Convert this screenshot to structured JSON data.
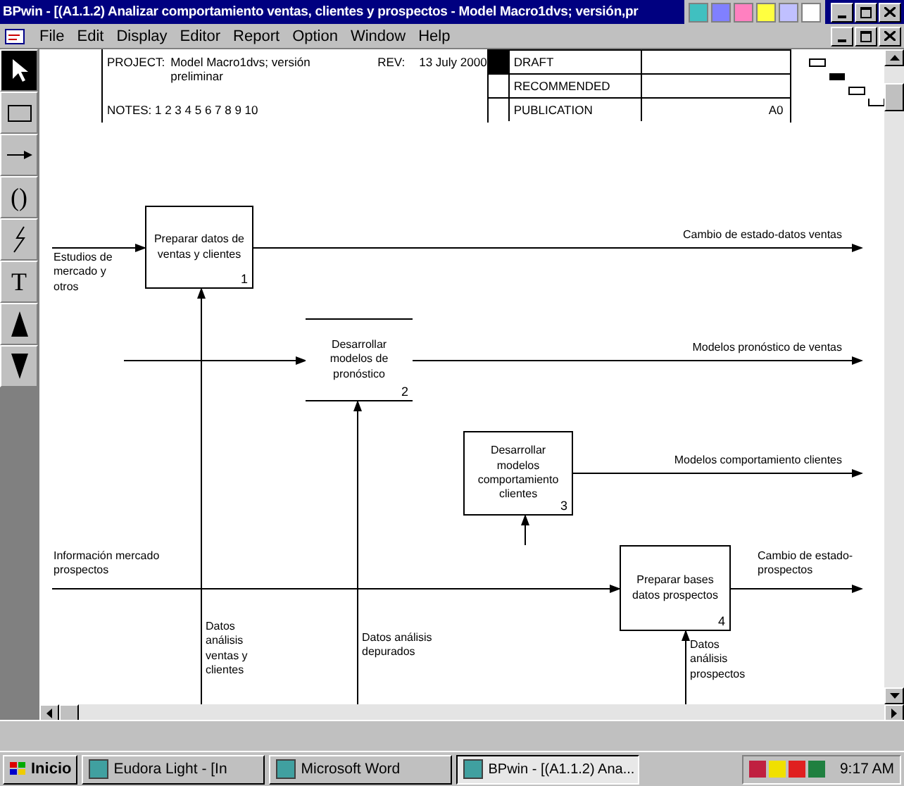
{
  "window": {
    "title": "BPwin - [(A1.1.2) Analizar comportamiento ventas, clientes y prospectos - Model Macro1dvs; versión,pr"
  },
  "menu": [
    "File",
    "Edit",
    "Display",
    "Editor",
    "Report",
    "Option",
    "Window",
    "Help"
  ],
  "tools": [
    {
      "kind": "pointer",
      "selected": true
    },
    {
      "kind": "rectangle",
      "selected": false
    },
    {
      "kind": "arrow",
      "selected": false
    },
    {
      "kind": "glyph",
      "glyph": "()",
      "selected": false
    },
    {
      "kind": "squiggle",
      "selected": false
    },
    {
      "kind": "glyph",
      "glyph": "T",
      "selected": false
    },
    {
      "kind": "up",
      "selected": false
    },
    {
      "kind": "down",
      "selected": false
    }
  ],
  "header": {
    "project_label": "PROJECT:",
    "project": "Model Macro1dvs; versión preliminar",
    "rev_label": "REV:",
    "rev": "13 July 2000",
    "notes": "NOTES: 1 2 3 4 5 6 7 8 9 10",
    "context": "A0",
    "statuses": [
      {
        "label": "DRAFT",
        "selected": true
      },
      {
        "label": "RECOMMENDED",
        "selected": false
      },
      {
        "label": "PUBLICATION",
        "selected": false
      }
    ]
  },
  "activities": [
    {
      "kind": "box",
      "name": "Preparar datos de ventas y clientes",
      "number": "1"
    },
    {
      "kind": "open",
      "name": "Desarrollar modelos de pronóstico",
      "number": "2"
    },
    {
      "kind": "box",
      "name": "Desarrollar modelos comportamiento clientes",
      "number": "3"
    },
    {
      "kind": "box",
      "name": "Preparar bases datos prospectos",
      "number": "4"
    }
  ],
  "arrow_labels": [
    "Estudios de mercado y otros",
    "Cambio de estado-datos ventas",
    "Modelos pronóstico de ventas",
    "Modelos comportamiento clientes",
    "Información mercado prospectos",
    "Cambio de estado-prospectos",
    "Datos análisis ventas y clientes",
    "Datos análisis depurados",
    "Datos análisis prospectos"
  ],
  "taskbar": {
    "start": "Inicio",
    "clock": "9:17 AM",
    "tasks": [
      {
        "label": "Eudora Light - [In",
        "selected": false
      },
      {
        "label": "Microsoft Word",
        "selected": false
      },
      {
        "label": "BPwin - [(A1.1.2) Ana...",
        "selected": true
      }
    ]
  }
}
